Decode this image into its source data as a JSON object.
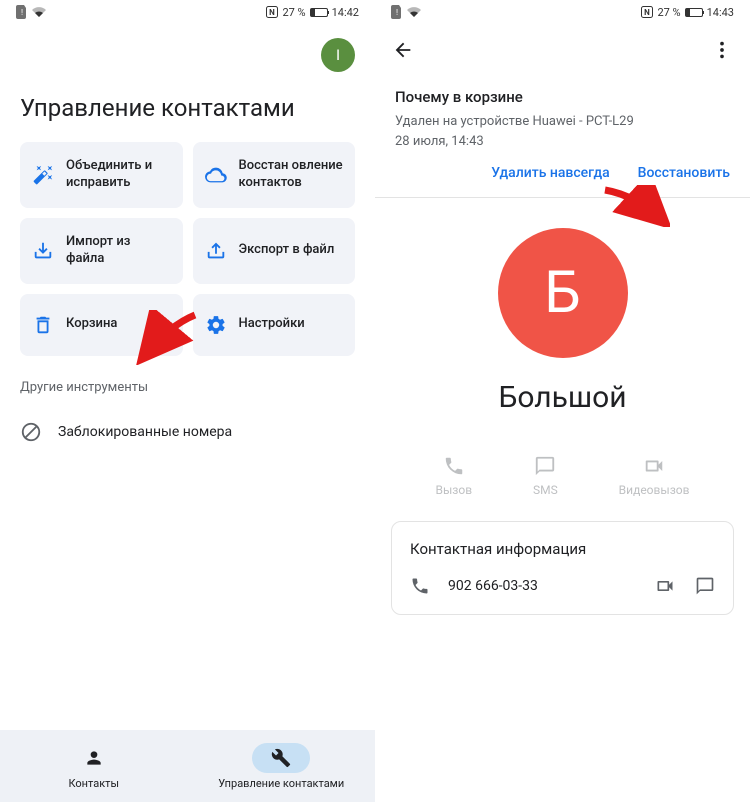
{
  "screen1": {
    "status": {
      "battery": "27 %",
      "time": "14:42"
    },
    "avatar_letter": "I",
    "title": "Управление контактами",
    "tiles": [
      {
        "label": "Объединить и исправить"
      },
      {
        "label": "Восстан овление контактов"
      },
      {
        "label": "Импорт из файла"
      },
      {
        "label": "Экспорт в файл"
      },
      {
        "label": "Корзина"
      },
      {
        "label": "Настройки"
      }
    ],
    "section": "Другие инструменты",
    "blocked": "Заблокированные номера",
    "nav": {
      "contacts": "Контакты",
      "manage": "Управление контактами"
    }
  },
  "screen2": {
    "status": {
      "battery": "27 %",
      "time": "14:43"
    },
    "trash": {
      "title": "Почему в корзине",
      "line1": "Удален на устройстве Huawei - PCT-L29",
      "line2": "28 июля, 14:43",
      "delete": "Удалить навсегда",
      "restore": "Восстановить"
    },
    "contact": {
      "letter": "Б",
      "name": "Большой"
    },
    "actions": {
      "call": "Вызов",
      "sms": "SMS",
      "video": "Видеовызов"
    },
    "info": {
      "title": "Контактная информация",
      "phone": "902 666-03-33"
    }
  }
}
